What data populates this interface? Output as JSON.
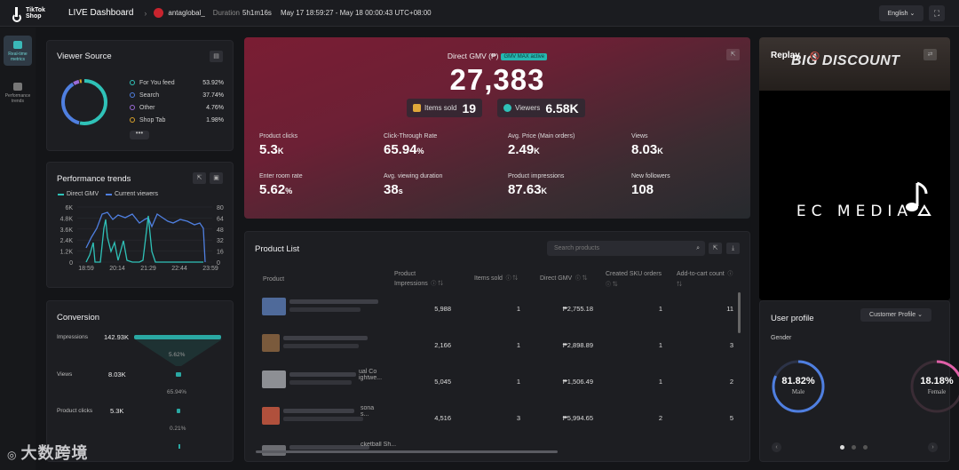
{
  "topbar": {
    "logo_line1": "TikTok",
    "logo_line2": "Shop",
    "title": "LIVE Dashboard",
    "separator": "›",
    "account": "antaglobal_",
    "duration_label": "Duration",
    "duration": "5h1m16s",
    "date_range": "May 17 18:59:27 - May 18 00:00:43 UTC+08:00",
    "language": "English ⌄",
    "fullscreen_icon": "⛶"
  },
  "sidebar": {
    "items": [
      {
        "label": "Real-time metrics",
        "icon": "dashboard-icon",
        "active": true
      },
      {
        "label": "Performance trends",
        "icon": "trends-icon",
        "active": false
      }
    ]
  },
  "viewer_source": {
    "title": "Viewer Source",
    "items": [
      {
        "label": "For You feed",
        "value": "53.92%",
        "color": "#2fc2b8",
        "share": 53.92
      },
      {
        "label": "Search",
        "value": "37.74%",
        "color": "#4f7fe0",
        "share": 37.74
      },
      {
        "label": "Other",
        "value": "4.76%",
        "color": "#9b6bd8",
        "share": 4.76
      },
      {
        "label": "Shop Tab",
        "value": "1.98%",
        "color": "#d8a12a",
        "share": 1.98
      }
    ],
    "more": "•••"
  },
  "performance_trends": {
    "title": "Performance trends",
    "legend": [
      "Direct GMV",
      "Current viewers"
    ],
    "left_ticks": [
      "6K",
      "4.8K",
      "3.6K",
      "2.4K",
      "1.2K",
      "0"
    ],
    "right_ticks": [
      "80",
      "64",
      "48",
      "32",
      "16",
      "0"
    ],
    "x_ticks": [
      "18:59",
      "20:14",
      "21:29",
      "22:44",
      "23:59"
    ]
  },
  "conversion": {
    "title": "Conversion",
    "stages": [
      {
        "label": "Impressions",
        "value": "142.93K"
      },
      {
        "label": "Views",
        "value": "8.03K"
      },
      {
        "label": "Product clicks",
        "value": "5.3K"
      }
    ],
    "rates": [
      "5.62%",
      "65.94%",
      "0.21%"
    ]
  },
  "gmv": {
    "label": "Direct GMV (₱)",
    "badge": "GMV MAX active",
    "value": "27,383",
    "items_sold_label": "Items sold",
    "items_sold": "19",
    "viewers_label": "Viewers",
    "viewers": "6.58K",
    "metrics": [
      {
        "label": "Product clicks",
        "value": "5.3",
        "unit": "K"
      },
      {
        "label": "Click-Through Rate",
        "value": "65.94",
        "unit": "%"
      },
      {
        "label": "Avg. Price (Main orders)",
        "value": "2.49",
        "unit": "K"
      },
      {
        "label": "Views",
        "value": "8.03",
        "unit": "K"
      },
      {
        "label": "Enter room rate",
        "value": "5.62",
        "unit": "%"
      },
      {
        "label": "Avg. viewing duration",
        "value": "38",
        "unit": "s"
      },
      {
        "label": "Product impressions",
        "value": "87.63",
        "unit": "K"
      },
      {
        "label": "New followers",
        "value": "108",
        "unit": ""
      }
    ]
  },
  "product_list": {
    "title": "Product List",
    "search_placeholder": "Search products",
    "headers": {
      "product": "Product",
      "impressions": "Product Impressions",
      "items_sold": "Items sold",
      "gmv": "Direct GMV",
      "created_sku": "Created SKU orders",
      "add_to_cart": "Add-to-cart count"
    },
    "rows": [
      {
        "name_fragment": "",
        "impressions": "5,988",
        "items_sold": "1",
        "gmv": "₱2,755.18",
        "sku_orders": "1",
        "add_to_cart": "11",
        "thumb": "#4f6a9a"
      },
      {
        "name_fragment": "",
        "impressions": "2,166",
        "items_sold": "1",
        "gmv": "₱2,898.89",
        "sku_orders": "1",
        "add_to_cart": "3",
        "thumb": "#7a5a3c"
      },
      {
        "name_fragment": "ual Co ightwe...",
        "impressions": "5,045",
        "items_sold": "1",
        "gmv": "₱1,506.49",
        "sku_orders": "1",
        "add_to_cart": "2",
        "thumb": "#8d8f94"
      },
      {
        "name_fragment": "sona s...",
        "impressions": "4,516",
        "items_sold": "3",
        "gmv": "₱5,994.65",
        "sku_orders": "2",
        "add_to_cart": "5",
        "thumb": "#b0503c"
      },
      {
        "name_fragment": "cketball Sh...",
        "impressions": "",
        "items_sold": "",
        "gmv": "",
        "sku_orders": "",
        "add_to_cart": "",
        "thumb": "#6c6d72"
      }
    ]
  },
  "replay": {
    "title": "Replay",
    "overlay_text": "BIG DISCOUNT",
    "brand": "EC MEDIA"
  },
  "user_profile": {
    "title": "User profile",
    "dropdown": "Customer Profile ⌄",
    "section": "Gender",
    "male_pct": "81.82%",
    "male_label": "Male",
    "male_share": 81.82,
    "female_pct": "18.18%",
    "female_label": "Female",
    "female_share": 18.18
  },
  "watermark": "大数跨境"
}
